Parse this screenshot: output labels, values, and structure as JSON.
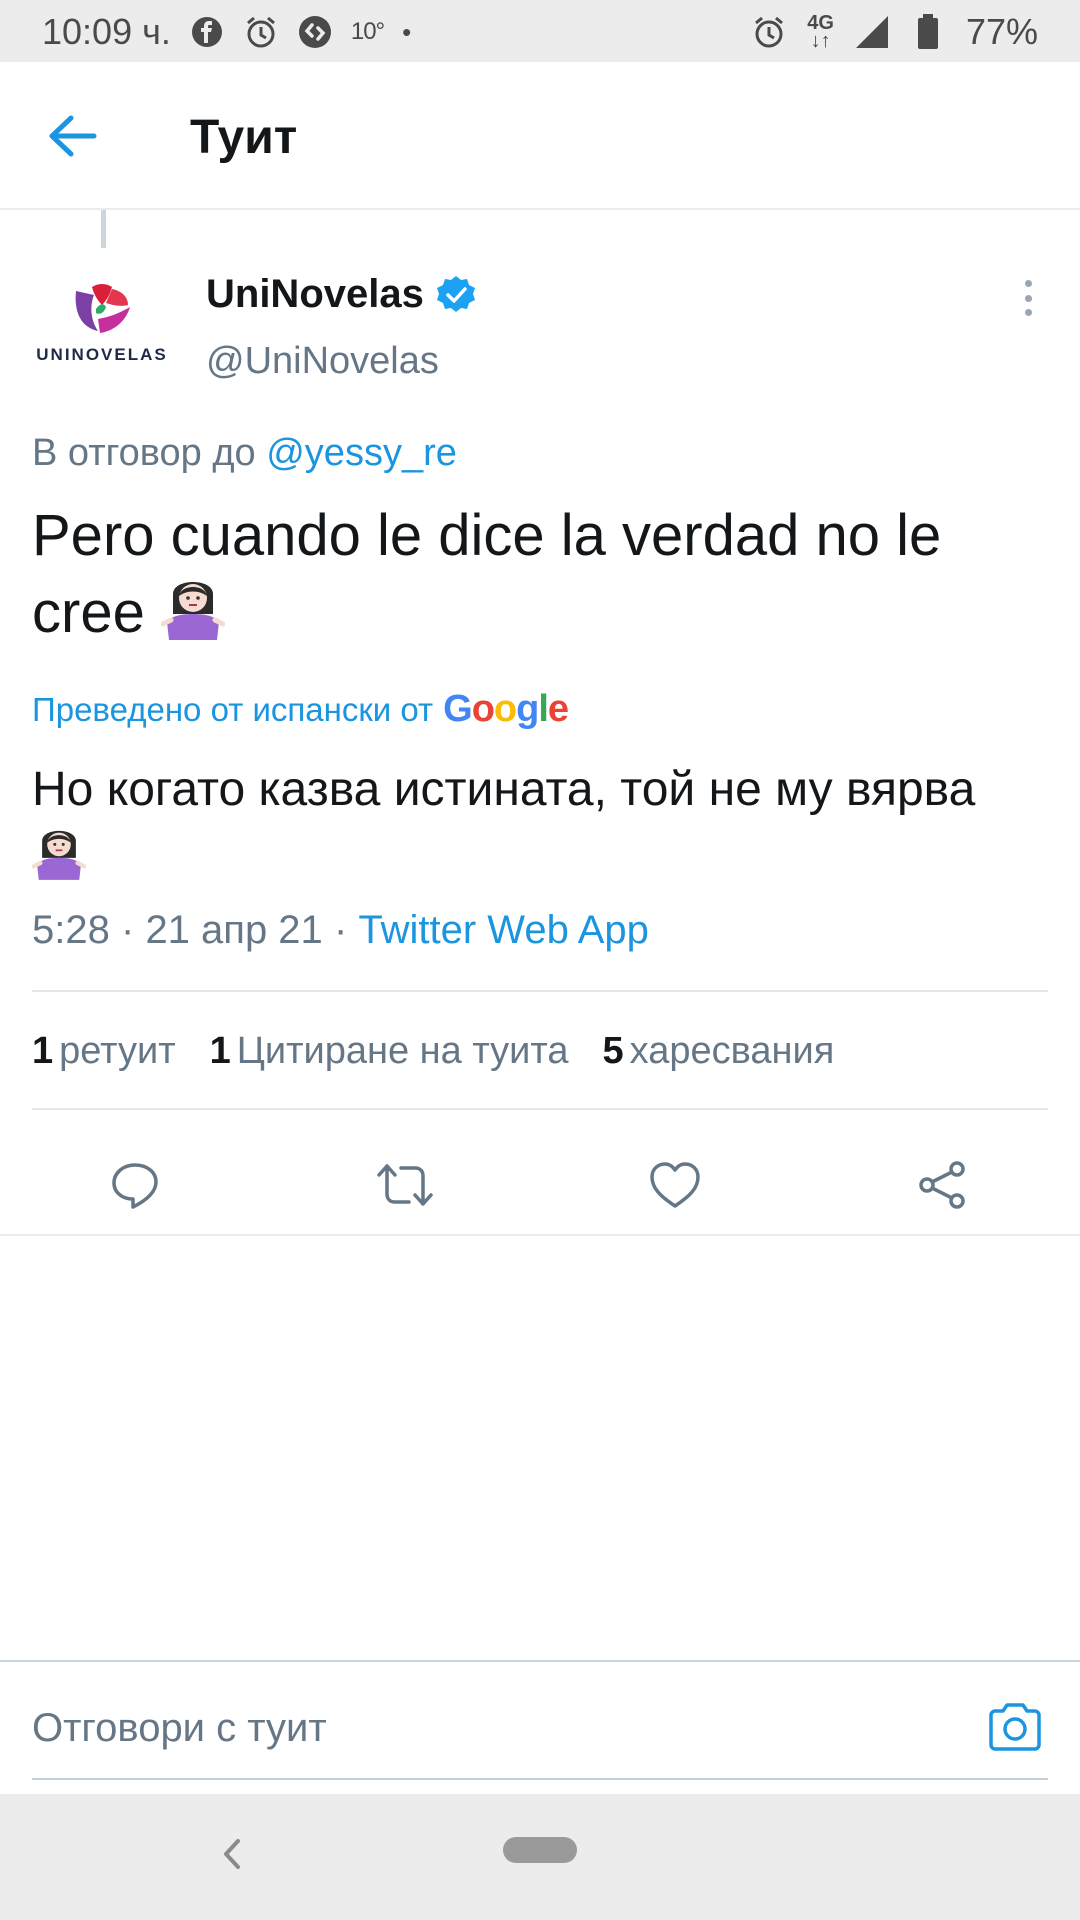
{
  "status_bar": {
    "time": "10:09 ч.",
    "temperature": "10°",
    "dot": "•",
    "network": "4G",
    "battery": "77%",
    "icons": [
      "facebook-icon",
      "alarm-icon",
      "shazam-icon",
      "alarm-icon",
      "4g-icon",
      "signal-icon",
      "battery-icon"
    ]
  },
  "app_bar": {
    "title": "Туит",
    "back_icon": "arrow-left-icon"
  },
  "tweet": {
    "author": {
      "name": "UniNovelas",
      "handle": "@UniNovelas",
      "verified": true,
      "avatar_text": "UNINOVELAS"
    },
    "reply_to_prefix": "В отговор до",
    "reply_to_handle": "@yessy_re",
    "text": "Pero cuando le dice la verdad no le cree",
    "translated_label": "Преведено от испански от",
    "translation_provider": "Google",
    "translation": "Но когато казва истината, той не му вярва",
    "time": "5:28",
    "date": "21 апр 21",
    "separator": "·",
    "source": "Twitter Web App",
    "stats": {
      "retweets_count": "1",
      "retweets_label": "ретуит",
      "quotes_count": "1",
      "quotes_label": "Цитиране на туита",
      "likes_count": "5",
      "likes_label": "харесвания"
    },
    "actions": [
      "reply-icon",
      "retweet-icon",
      "like-icon",
      "share-icon"
    ]
  },
  "composer": {
    "placeholder": "Отговори с туит",
    "camera_icon": "camera-icon"
  },
  "colors": {
    "accent": "#1b95e0",
    "secondary_text": "#657786",
    "primary_text": "#14171a"
  }
}
